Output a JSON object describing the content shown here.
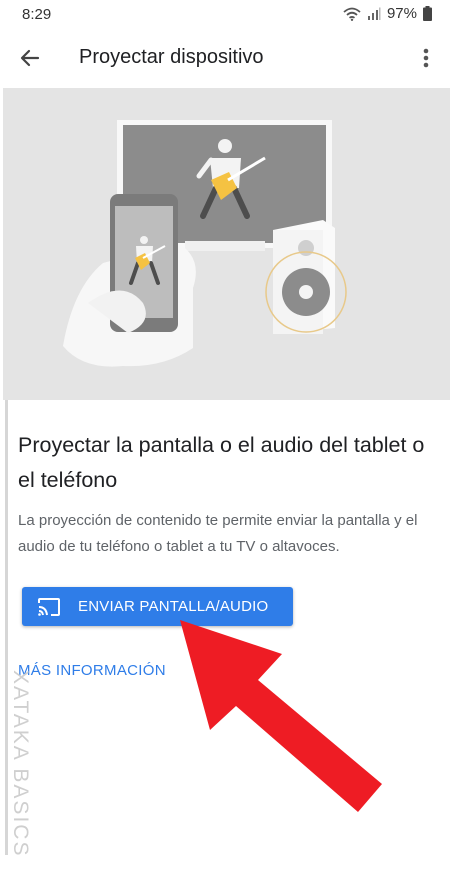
{
  "status_bar": {
    "time": "8:29",
    "battery": "97%"
  },
  "app_bar": {
    "title": "Proyectar dispositivo"
  },
  "content": {
    "heading": "Proyectar la pantalla o el audio del tablet o el teléfono",
    "description": "La proyección de contenido te permite enviar la pantalla y el audio de tu teléfono o tablet a tu TV o altavoces.",
    "cast_button_label": "ENVIAR PANTALLA/AUDIO",
    "more_info_label": "MÁS INFORMACIÓN"
  },
  "watermark": {
    "text": "XATAKA BASICS"
  },
  "colors": {
    "accent": "#2f7de8",
    "annotation_arrow": "#ee1c24"
  },
  "icons": [
    "back-arrow-icon",
    "more-vert-icon",
    "cast-icon",
    "wifi-icon",
    "signal-icon",
    "battery-icon"
  ]
}
